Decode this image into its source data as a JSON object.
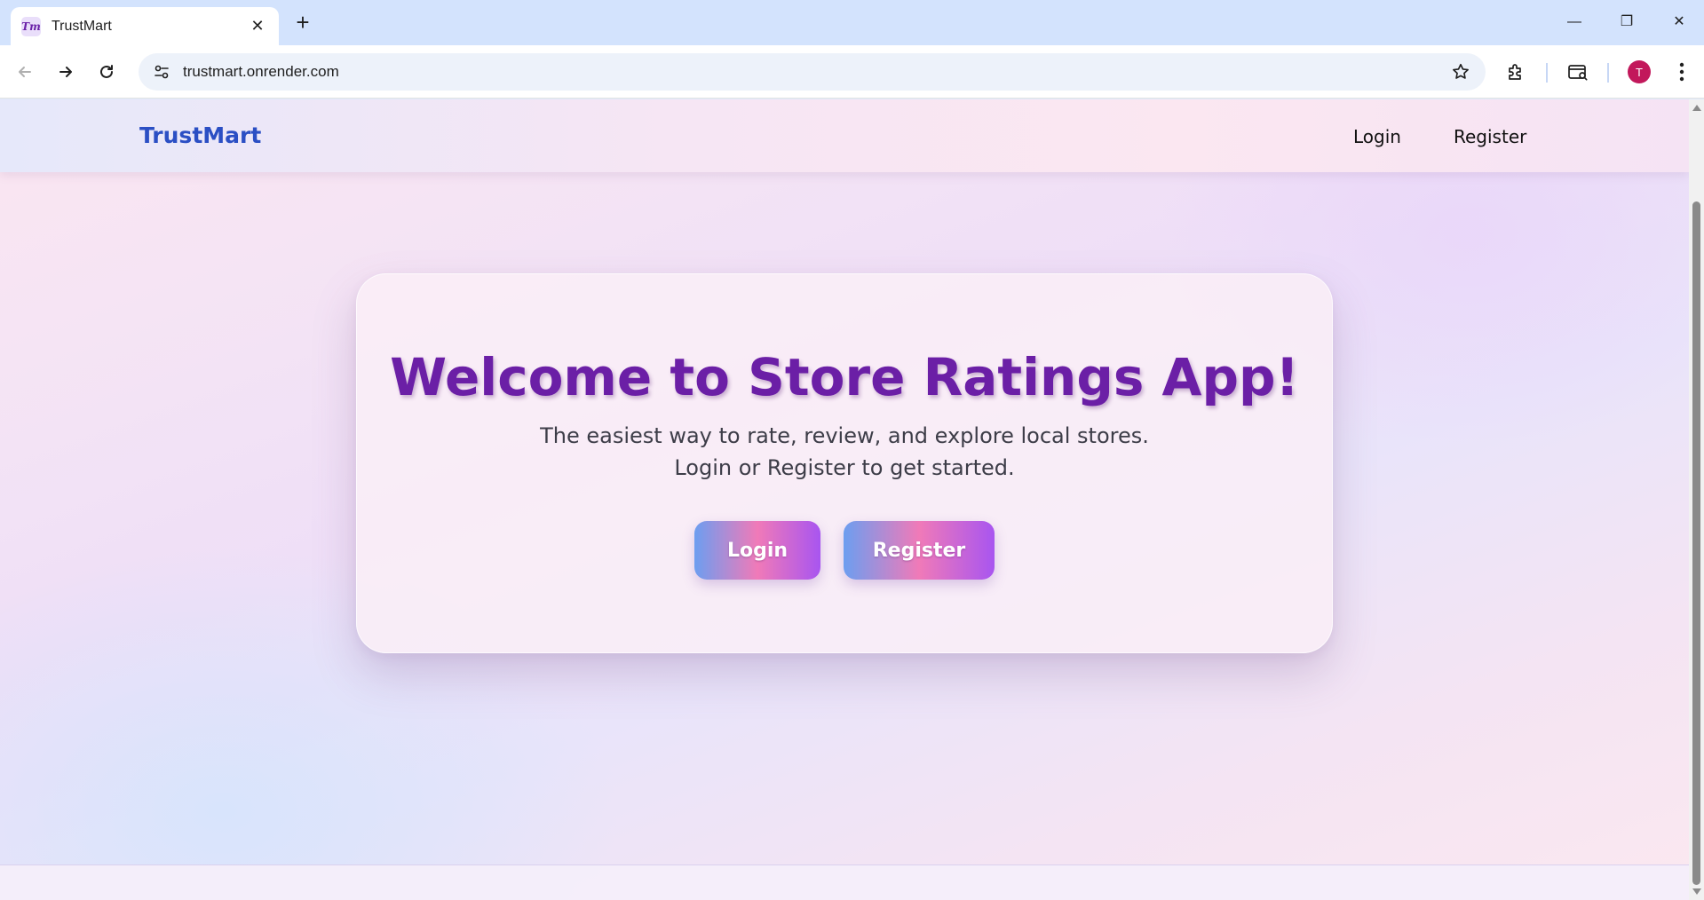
{
  "browser": {
    "tab": {
      "favicon_text": "Tm",
      "title": "TrustMart",
      "close_glyph": "✕"
    },
    "new_tab_glyph": "+",
    "window_controls": {
      "minimize": "—",
      "restore": "❐",
      "close": "✕"
    },
    "address": {
      "url": "trustmart.onrender.com"
    },
    "profile_initial": "T"
  },
  "site": {
    "brand": "TrustMart",
    "nav": {
      "login": "Login",
      "register": "Register"
    }
  },
  "hero": {
    "title": "Welcome to Store Ratings App!",
    "subtitle_line1": "The easiest way to rate, review, and explore local stores.",
    "subtitle_line2": "Login or Register to get started.",
    "login_button": "Login",
    "register_button": "Register"
  },
  "colors": {
    "brand_blue": "#2b4fc4",
    "title_purple": "#6b1fa6",
    "button_gradient_start": "#6c9ef0",
    "button_gradient_mid": "#f07ab8",
    "button_gradient_end": "#a855f0",
    "avatar": "#c2185b"
  }
}
